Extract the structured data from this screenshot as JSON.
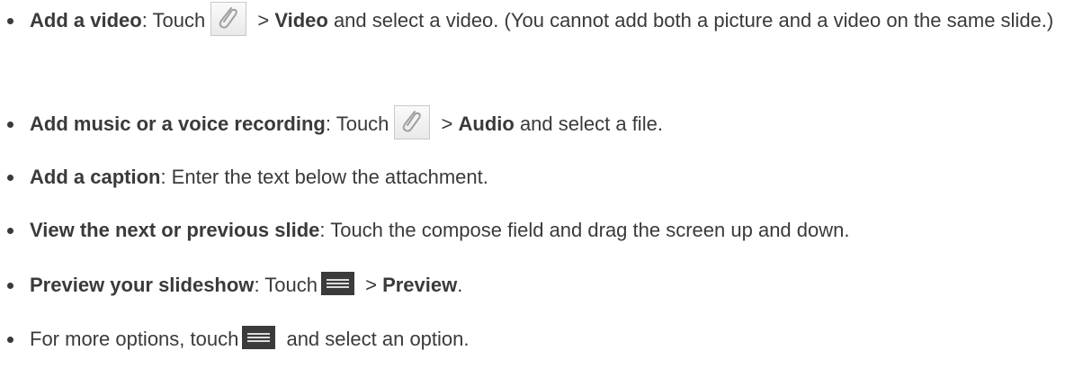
{
  "items": [
    {
      "bold": "Add a video",
      "p1": ": Touch",
      "p2": " > ",
      "bold2": "Video",
      "p3": " and select a video. (You cannot add both a picture and a video on the same slide.)"
    },
    {
      "bold": "Add music or a voice recording",
      "p1": ": Touch",
      "p2": " > ",
      "bold2": "Audio",
      "p3": " and select a file."
    },
    {
      "bold": "Add a caption",
      "p1": ": Enter the text below the attachment."
    },
    {
      "bold": "View the next or previous slide",
      "p1": ": Touch the compose field and drag the screen up and down."
    },
    {
      "bold": "Preview your slideshow",
      "p1": ": Touch",
      "p2": " > ",
      "bold2": "Preview",
      "p3": "."
    },
    {
      "p1": "For more options, touch",
      "p3": " and select an option."
    }
  ],
  "icons": {
    "attach": "paperclip-icon",
    "menu": "menu-icon"
  },
  "colors": {
    "text": "#3a3a3a",
    "menu_icon_bg": "#3b3b3b"
  }
}
